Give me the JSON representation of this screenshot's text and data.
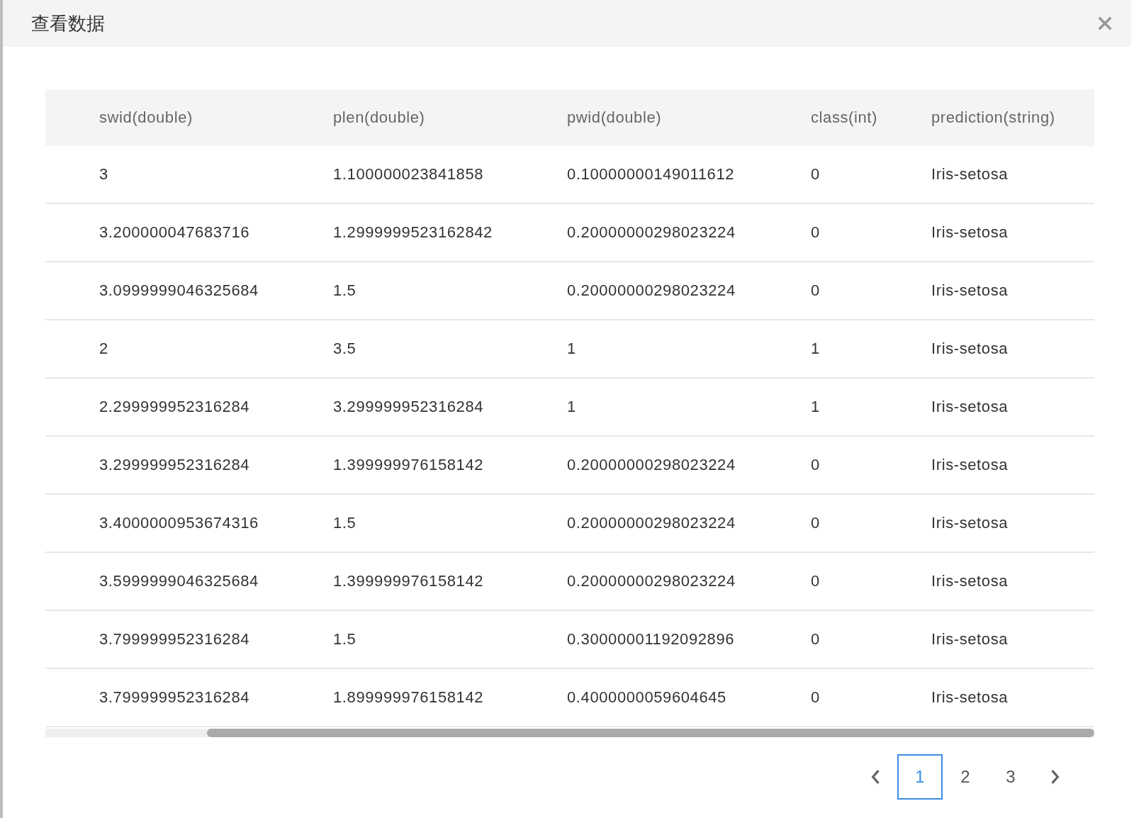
{
  "dialog": {
    "title": "查看数据"
  },
  "table": {
    "columns": [
      "swid(double)",
      "plen(double)",
      "pwid(double)",
      "class(int)",
      "prediction(string)"
    ],
    "rows": [
      [
        "3",
        "1.100000023841858",
        "0.10000000149011612",
        "0",
        "Iris-setosa"
      ],
      [
        "3.200000047683716",
        "1.2999999523162842",
        "0.20000000298023224",
        "0",
        "Iris-setosa"
      ],
      [
        "3.0999999046325684",
        "1.5",
        "0.20000000298023224",
        "0",
        "Iris-setosa"
      ],
      [
        "2",
        "3.5",
        "1",
        "1",
        "Iris-setosa"
      ],
      [
        "2.299999952316284",
        "3.299999952316284",
        "1",
        "1",
        "Iris-setosa"
      ],
      [
        "3.299999952316284",
        "1.399999976158142",
        "0.20000000298023224",
        "0",
        "Iris-setosa"
      ],
      [
        "3.4000000953674316",
        "1.5",
        "0.20000000298023224",
        "0",
        "Iris-setosa"
      ],
      [
        "3.5999999046325684",
        "1.399999976158142",
        "0.20000000298023224",
        "0",
        "Iris-setosa"
      ],
      [
        "3.799999952316284",
        "1.5",
        "0.30000001192092896",
        "0",
        "Iris-setosa"
      ],
      [
        "3.799999952316284",
        "1.899999976158142",
        "0.4000000059604645",
        "0",
        "Iris-setosa"
      ]
    ]
  },
  "pagination": {
    "pages": [
      {
        "label": "1",
        "selected": true
      },
      {
        "label": "2",
        "selected": false
      },
      {
        "label": "3",
        "selected": false
      }
    ]
  }
}
